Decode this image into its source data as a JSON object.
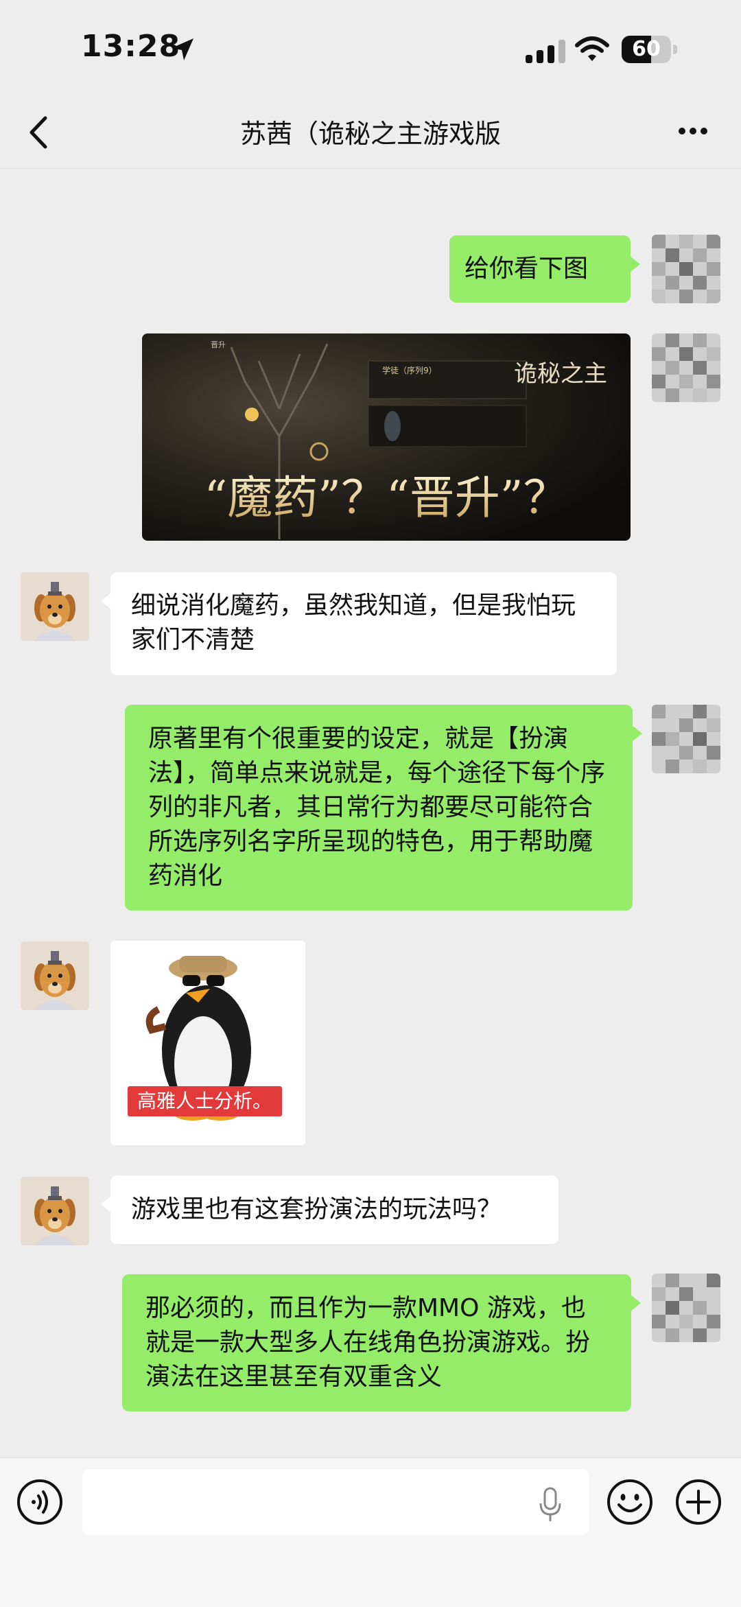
{
  "status_bar": {
    "time": "13:28",
    "battery": "60",
    "battery_level": 0.6
  },
  "header": {
    "title": "苏茜（诡秘之主游戏版"
  },
  "messages": {
    "m1": "给你看下图",
    "m2_image": {
      "game_logo": "诡秘之主",
      "caption": "“魔药”？“晋升”？",
      "ui_label_1": "晋升",
      "ui_label_2": "学徒（序列9）"
    },
    "m3": "细说消化魔药，虽然我知道，但是我怕玩家们不清楚",
    "m4": "原著里有个很重要的设定，就是【扮演法】，简单点来说就是，每个途径下每个序列的非凡者，其日常行为都要尽可能符合所选序列名字所呈现的特色，用于帮助魔药消化",
    "m5_sticker": {
      "caption": "高雅人士分析。"
    },
    "m6": "游戏里也有这套扮演法的玩法吗？",
    "m7": "那必须的，而且作为一款MMO 游戏，也就是一款大型多人在线角色扮演游戏。扮演法在这里甚至有双重含义"
  },
  "colors": {
    "bubble_me": "#95ec69",
    "bubble_them": "#ffffff",
    "background": "#ededed"
  },
  "icons": [
    "location-arrow-icon",
    "signal-icon",
    "wifi-icon",
    "battery-icon",
    "back-icon",
    "more-icon",
    "voice-icon",
    "mic-icon",
    "emoji-icon",
    "plus-icon"
  ]
}
